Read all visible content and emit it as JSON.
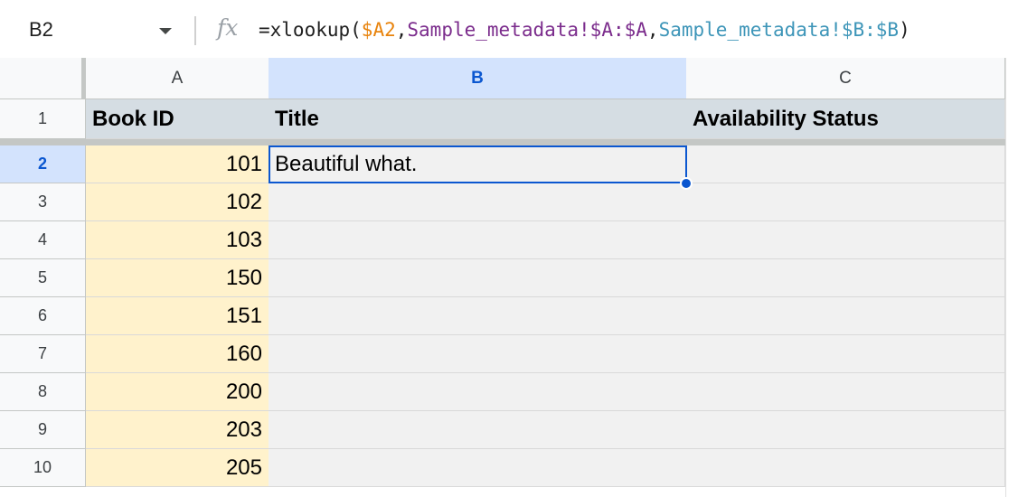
{
  "formula_bar": {
    "name_box": "B2",
    "fx_label": "fx",
    "formula_parts": [
      {
        "text": "=xlookup(",
        "color": "#1f1f1f"
      },
      {
        "text": "$A2",
        "color": "#e8830c"
      },
      {
        "text": ",",
        "color": "#1f1f1f"
      },
      {
        "text": "Sample_metadata!$A:$A",
        "color": "#7b2c8c"
      },
      {
        "text": ",",
        "color": "#1f1f1f"
      },
      {
        "text": "Sample_metadata!$B:$B",
        "color": "#3d95b8"
      },
      {
        "text": ")",
        "color": "#1f1f1f"
      }
    ]
  },
  "columns": [
    "A",
    "B",
    "C"
  ],
  "selected_column": "B",
  "selected_row": "2",
  "header_row": {
    "number": "1",
    "cells": [
      "Book ID",
      "Title",
      "Availability Status"
    ]
  },
  "rows": [
    {
      "number": "2",
      "book_id": "101",
      "title": "Beautiful what.",
      "status": ""
    },
    {
      "number": "3",
      "book_id": "102",
      "title": "",
      "status": ""
    },
    {
      "number": "4",
      "book_id": "103",
      "title": "",
      "status": ""
    },
    {
      "number": "5",
      "book_id": "150",
      "title": "",
      "status": ""
    },
    {
      "number": "6",
      "book_id": "151",
      "title": "",
      "status": ""
    },
    {
      "number": "7",
      "book_id": "160",
      "title": "",
      "status": ""
    },
    {
      "number": "8",
      "book_id": "200",
      "title": "",
      "status": ""
    },
    {
      "number": "9",
      "book_id": "203",
      "title": "",
      "status": ""
    },
    {
      "number": "10",
      "book_id": "205",
      "title": "",
      "status": ""
    }
  ],
  "colors": {
    "accent": "#0b57d0",
    "id_column_fill": "#fff2cc",
    "header_fill": "#d5dde3"
  }
}
